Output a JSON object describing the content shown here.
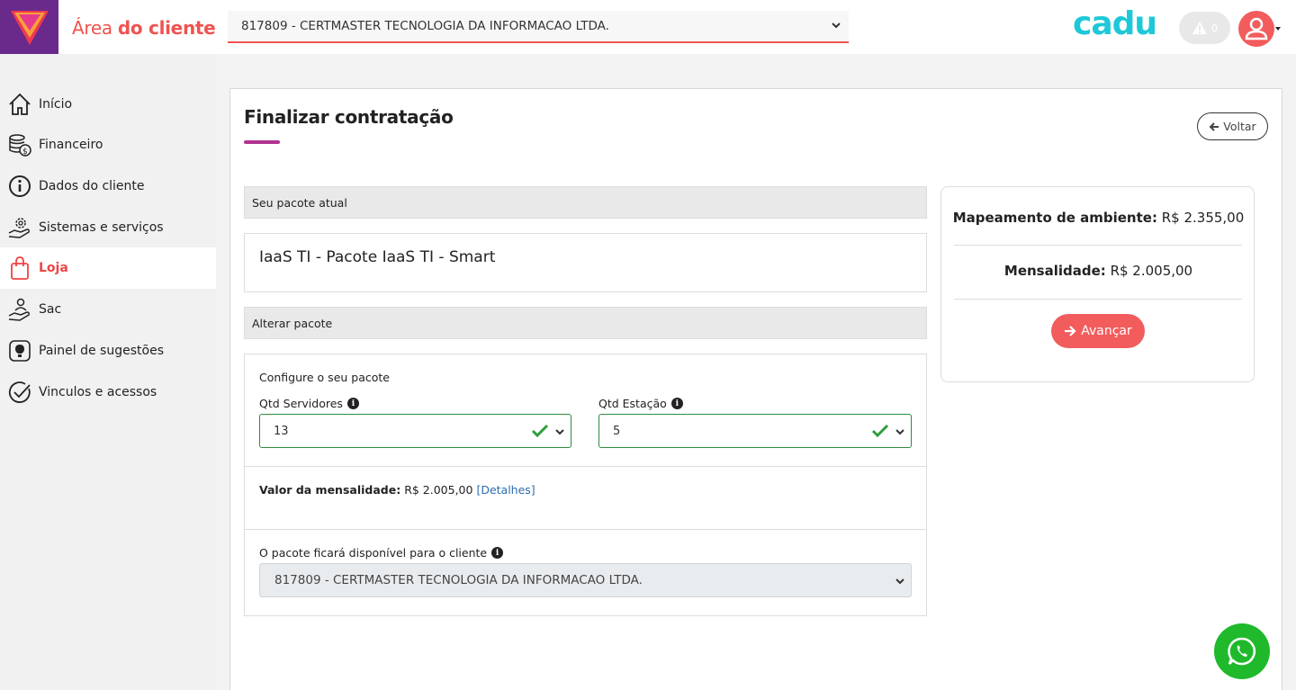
{
  "header": {
    "app_title_prefix": "Área",
    "app_title_suffix": "do cliente",
    "client_select_value": "817809 - CERTMASTER TECNOLOGIA DA INFORMACAO LTDA.",
    "brand": "cadu",
    "alert_count": "0",
    "accent_color": "#ef5350"
  },
  "sidebar": {
    "items": [
      {
        "label": "Início",
        "icon": "home-icon"
      },
      {
        "label": "Financeiro",
        "icon": "coins-icon"
      },
      {
        "label": "Dados do cliente",
        "icon": "info-icon"
      },
      {
        "label": "Sistemas e serviços",
        "icon": "gear-hand-icon"
      },
      {
        "label": "Loja",
        "icon": "shopping-bag-icon",
        "active": true
      },
      {
        "label": "Sac",
        "icon": "hand-support-icon"
      },
      {
        "label": "Painel de sugestões",
        "icon": "lightbulb-icon"
      },
      {
        "label": "Vinculos e acessos",
        "icon": "check-circle-icon"
      }
    ]
  },
  "main": {
    "title": "Finalizar contratação",
    "back_label": "Voltar",
    "current_package_header": "Seu pacote atual",
    "current_package_name": "IaaS TI - Pacote IaaS TI - Smart",
    "change_package_header": "Alterar pacote",
    "configure_label": "Configure o seu pacote",
    "servers_label": "Qtd Servidores",
    "servers_value": "13",
    "stations_label": "Qtd Estação",
    "stations_value": "5",
    "monthly_label": "Valor da mensalidade:",
    "monthly_value": "R$ 2.005,00",
    "details_link": "[Detalhes]",
    "availability_label": "O pacote ficará disponível para o cliente",
    "availability_value": "817809 - CERTMASTER TECNOLOGIA DA INFORMACAO LTDA."
  },
  "summary": {
    "mapping_label": "Mapeamento de ambiente:",
    "mapping_value": "R$ 2.355,00",
    "monthly_label": "Mensalidade:",
    "monthly_value": "R$ 2.005,00",
    "advance_label": "Avançar"
  },
  "colors": {
    "valid_green": "#2e8b3e",
    "brand_cyan": "#1ec8d8",
    "purple": "#6a2a8c",
    "whatsapp_green": "#1fb92b"
  }
}
